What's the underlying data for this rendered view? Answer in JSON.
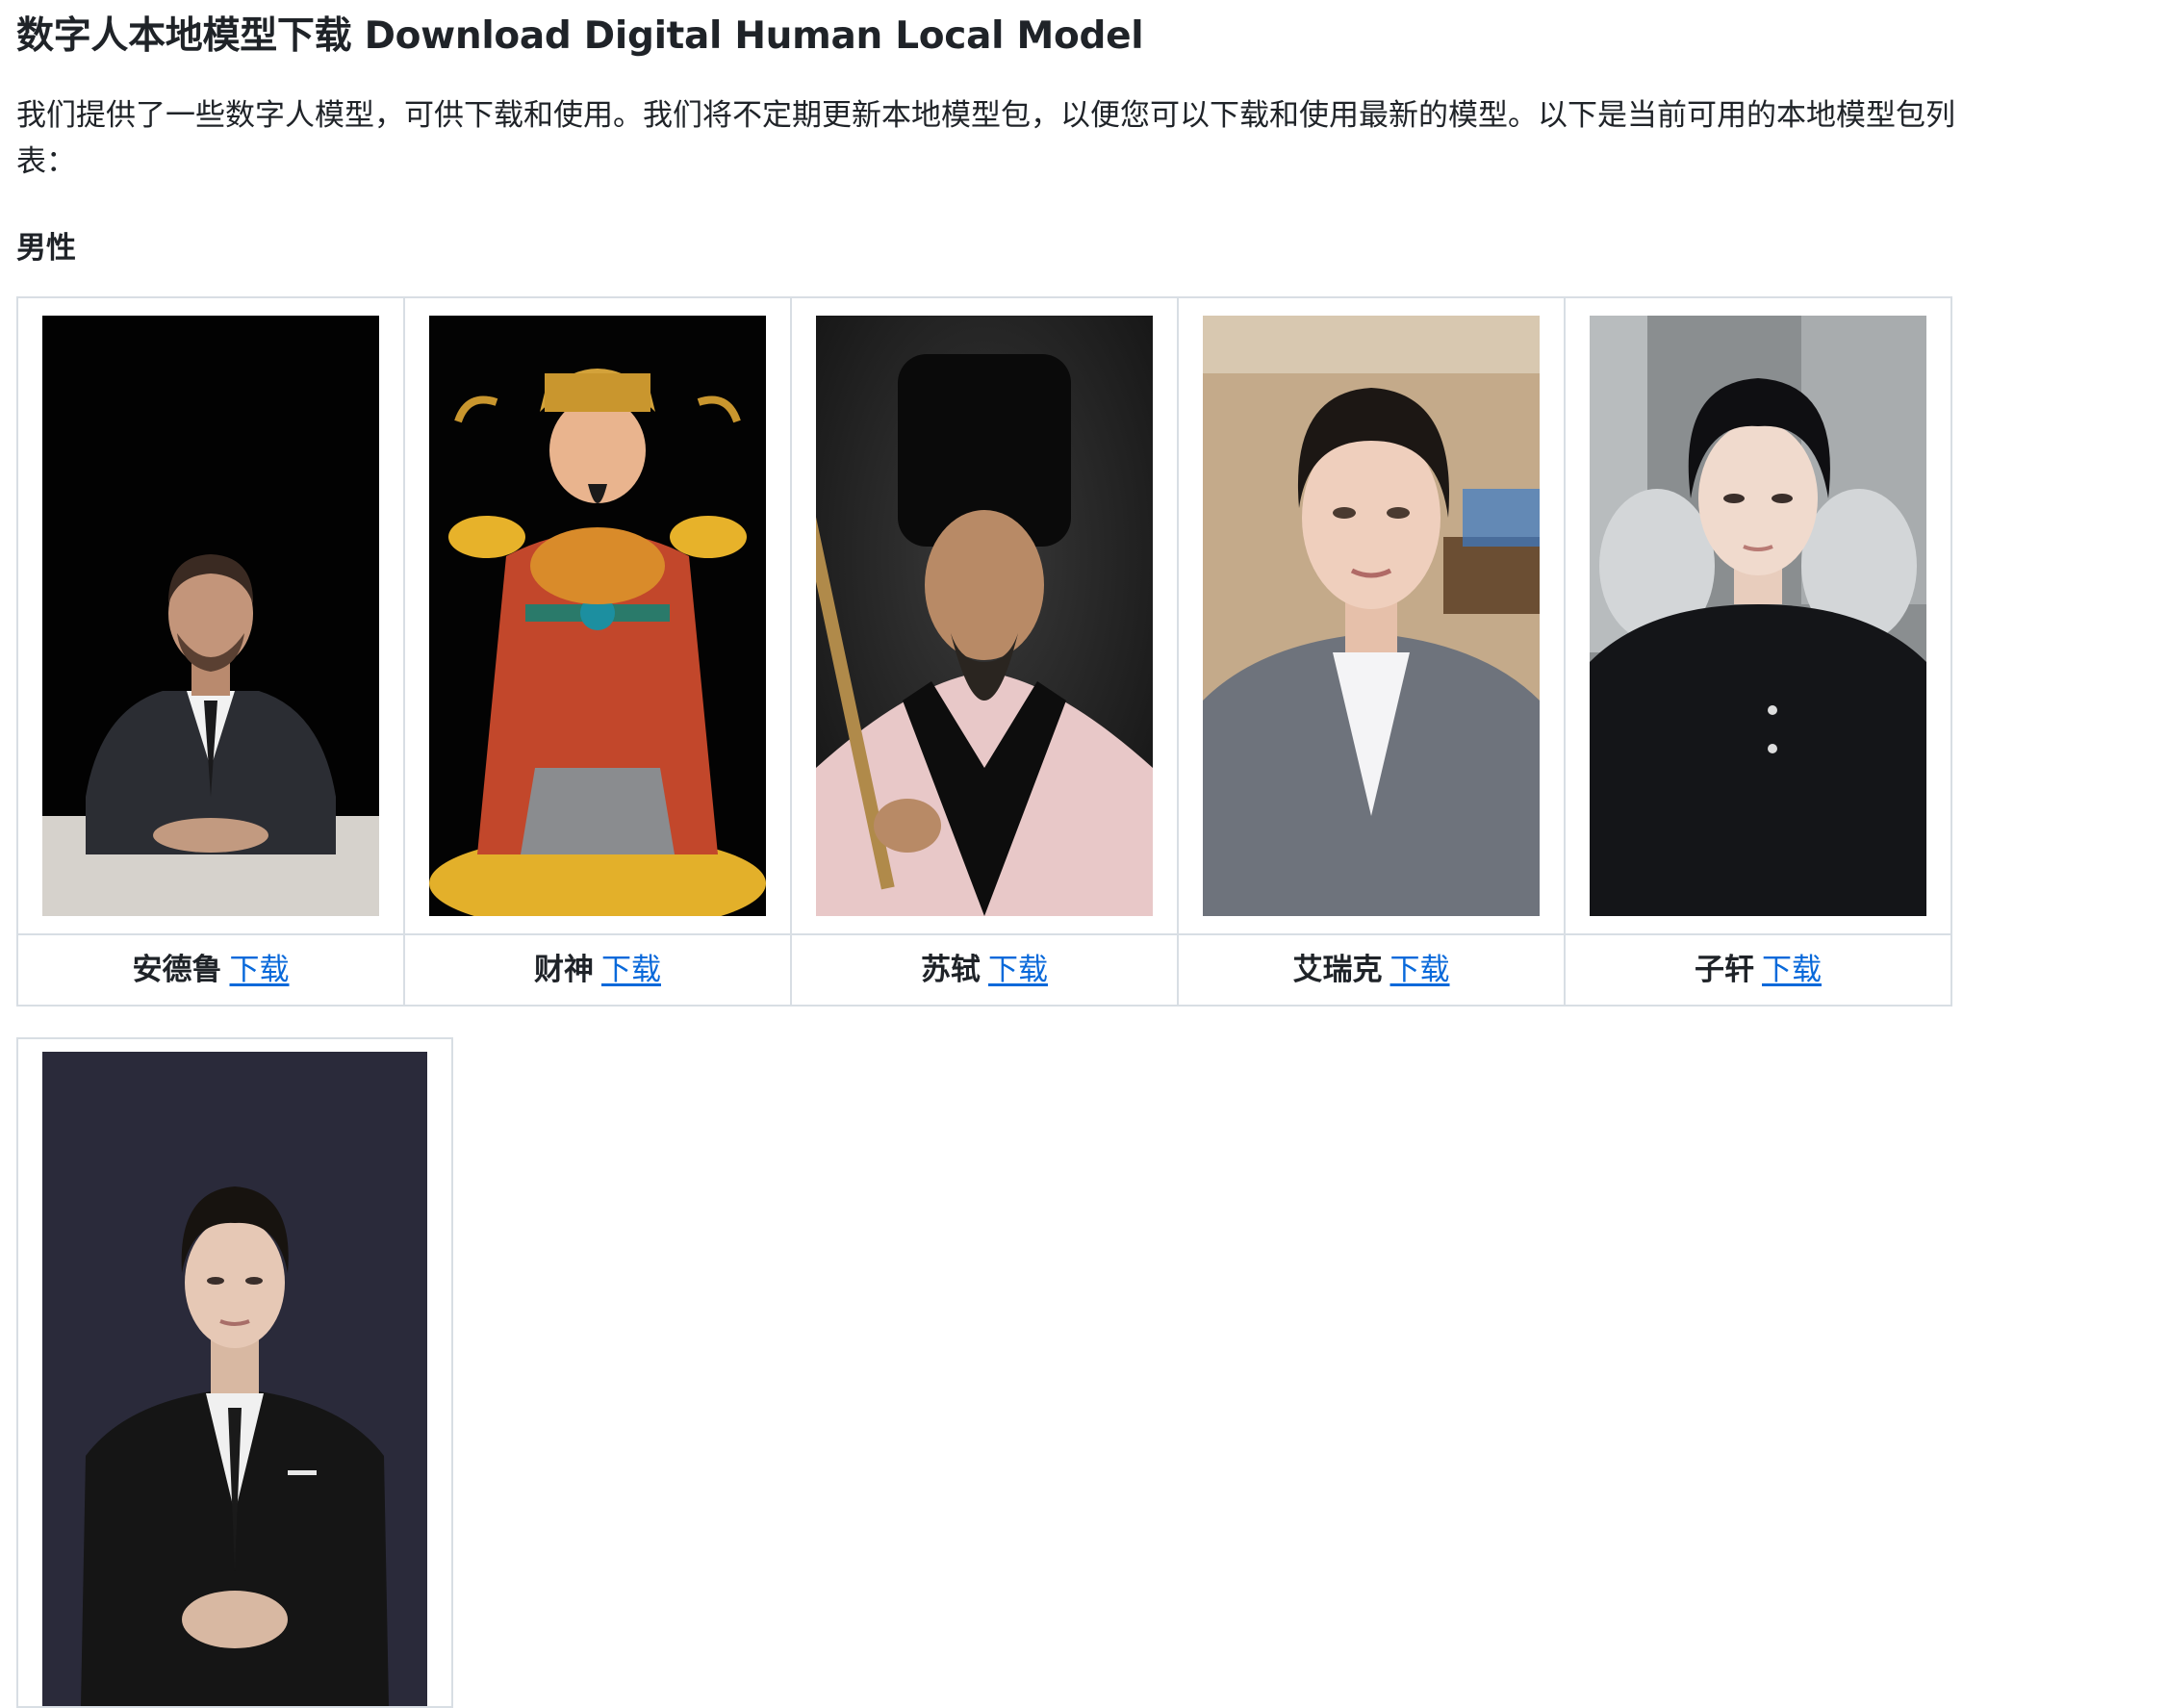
{
  "page": {
    "title": "数字人本地模型下载 Download Digital Human Local Model",
    "intro": "我们提供了一些数字人模型，可供下载和使用。我们将不定期更新本地模型包，以便您可以下载和使用最新的模型。以下是当前可用的本地模型包列表：",
    "section_male": "男性"
  },
  "models_row1": [
    {
      "name": "安德鲁",
      "link": "下载",
      "image": "man-in-suit-at-desk"
    },
    {
      "name": "财神",
      "link": "下载",
      "image": "god-of-wealth-figure"
    },
    {
      "name": "苏轼",
      "link": "下载",
      "image": "scholar-with-black-hat"
    },
    {
      "name": "艾瑞克",
      "link": "下载",
      "image": "young-man-grey-suit"
    },
    {
      "name": "子轩",
      "link": "下载",
      "image": "young-man-black-shirt"
    }
  ],
  "models_row2": [
    {
      "image": "man-in-black-suit-standing"
    }
  ],
  "colors": {
    "link": "#0969da",
    "border": "#d8dee4",
    "text": "#1f2328"
  }
}
